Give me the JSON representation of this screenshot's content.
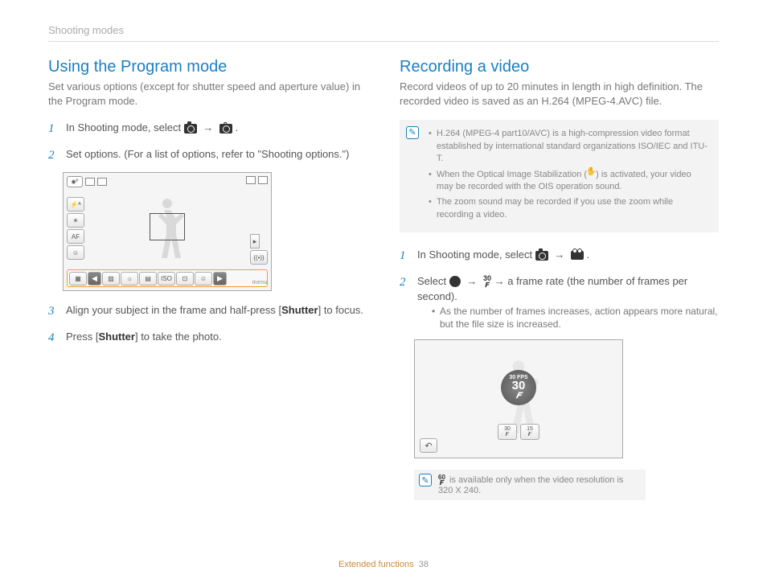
{
  "breadcrumb": "Shooting modes",
  "left": {
    "heading": "Using the Program mode",
    "intro": "Set various options (except for shutter speed and aperture value) in the Program mode.",
    "step1_pre": "In Shooting mode, select ",
    "step1_post": ".",
    "step2": "Set options. (For a list of options, refer to \"Shooting options.\")",
    "step3_pre": "Align your subject in the frame and half-press [",
    "step3_mid": "Shutter",
    "step3_post": "] to focus.",
    "step4_pre": "Press [",
    "step4_mid": "Shutter",
    "step4_post": "] to take the photo.",
    "menu_label": "menu"
  },
  "right": {
    "heading": "Recording a video",
    "intro": "Record videos of up to 20 minutes in length in high definition. The recorded video is saved as an H.264 (MPEG-4.AVC) file.",
    "notes": [
      "H.264 (MPEG-4 part10/AVC) is a high-compression video format established by international standard organizations ISO/IEC and ITU-T.",
      "When the Optical Image Stabilization (    ) is activated, your video may be recorded with the OIS operation sound.",
      "The zoom sound may be recorded if you use the zoom while recording a video."
    ],
    "step1_pre": "In Shooting mode, select ",
    "step1_post": ".",
    "step2_pre": "Select ",
    "step2_mid": " → a frame rate (the number of frames per second).",
    "step2_sub": "As the number of frames increases, action appears more natural, but the file size is increased.",
    "badge_top": "30 FPS",
    "badge_mid": "30",
    "fps30": "30",
    "fps15": "15",
    "footnote_pre": "",
    "footnote": " is available only when the video resolution is 320 X 240.",
    "sixty_label": "60"
  },
  "footer": {
    "section": "Extended functions",
    "page": "38"
  },
  "arrow": "→"
}
